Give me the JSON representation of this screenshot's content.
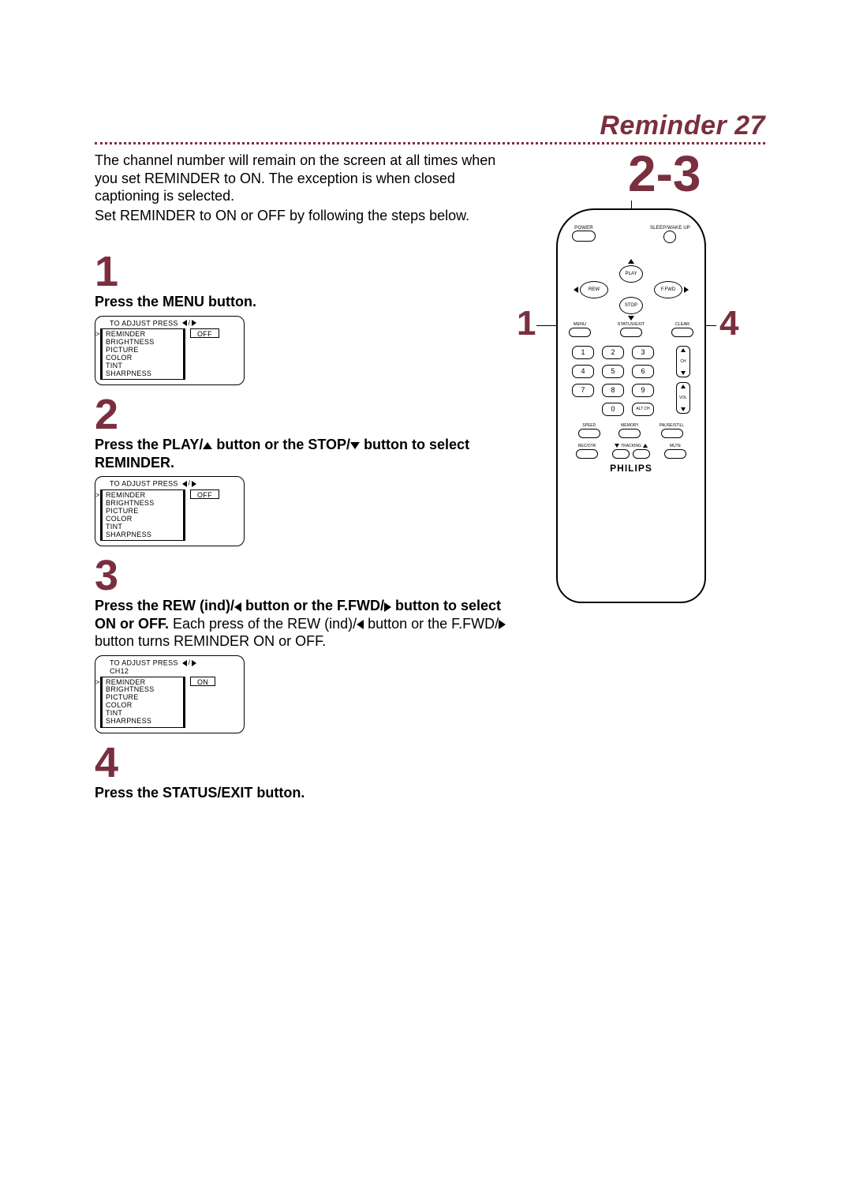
{
  "title": "Reminder 27",
  "intro": {
    "p1": "The channel number will remain on the screen at all times when you set REMINDER to ON. The exception is when closed captioning is selected.",
    "p2": "Set REMINDER to ON or OFF by following the steps below."
  },
  "callouts": {
    "big": "2-3",
    "left": "1",
    "right": "4"
  },
  "steps": {
    "s1": {
      "num": "1",
      "bold": "Press the MENU button."
    },
    "s2": {
      "num": "2",
      "bold1": "Press the PLAY/",
      "bold2": " button or the STOP/",
      "bold3": " button to select REMINDER."
    },
    "s3": {
      "num": "3",
      "bold1": "Press the REW (ind)/",
      "bold2": " button or the F.FWD/",
      "bold3": " button to select ON or OFF.",
      "tail1": " Each press of the REW (ind)/",
      "tail2": " button or the F.FWD/",
      "tail3": " button turns REMINDER ON or OFF."
    },
    "s4": {
      "num": "4",
      "bold": "Press the STATUS/EXIT button."
    }
  },
  "osd": {
    "header": "TO ADJUST PRESS",
    "ch": "CH12",
    "items": [
      "REMINDER",
      "BRIGHTNESS",
      "PICTURE",
      "COLOR",
      "TINT",
      "SHARPNESS"
    ],
    "off": "OFF",
    "on": "ON"
  },
  "remote": {
    "power": "POWER",
    "sleep": "SLEEP/WAKE UP",
    "play": "PLAY",
    "stop": "STOP",
    "rew": "REW",
    "ffwd": "F.FWD",
    "menu": "MENU",
    "status": "STATUS/EXIT",
    "clear": "CLEAR",
    "keys": [
      "1",
      "2",
      "3",
      "4",
      "5",
      "6",
      "7",
      "8",
      "9"
    ],
    "zero": "0",
    "altch": "ALT CH",
    "ch": "CH",
    "vol": "VOL",
    "speed": "SPEED",
    "memory": "MEMORY",
    "pause": "PAUSE/STILL",
    "recotr": "REC/OTR",
    "tracking": "TRACKING",
    "mute": "MUTE",
    "brand": "PHILIPS"
  }
}
